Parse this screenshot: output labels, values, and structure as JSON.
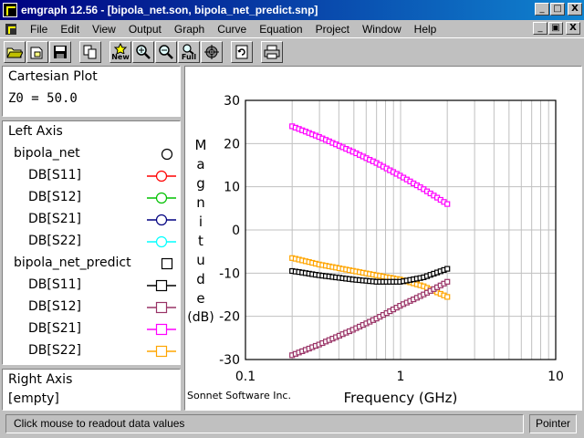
{
  "window": {
    "title": "emgraph 12.56 - [bipola_net.son, bipola_net_predict.snp]",
    "minimize": "_",
    "maximize": "□",
    "close": "X",
    "mdi_restore": "▣"
  },
  "menu": {
    "items": [
      {
        "label": "File",
        "key": "F",
        "rest": "ile"
      },
      {
        "label": "Edit",
        "key": "E",
        "rest": "dit"
      },
      {
        "label": "View",
        "key": "V",
        "rest": "iew"
      },
      {
        "label": "Output",
        "key": "O",
        "rest": "utput"
      },
      {
        "label": "Graph",
        "key": "G",
        "rest": "raph"
      },
      {
        "label": "Curve",
        "key": "C",
        "rest": "urve"
      },
      {
        "label": "Equation",
        "key": "q",
        "pre": "E",
        "rest": "uation"
      },
      {
        "label": "Project",
        "key": "P",
        "rest": "roject"
      },
      {
        "label": "Window",
        "key": "W",
        "rest": "indow"
      },
      {
        "label": "Help",
        "key": "H",
        "rest": "elp"
      }
    ]
  },
  "toolbar": {
    "new_label": "New",
    "full_label": "Full"
  },
  "left_panel": {
    "plot_type": "Cartesian Plot",
    "z0": "Z0 = 50.0",
    "left_axis_label": "Left Axis",
    "groups": [
      {
        "name": "bipola_net",
        "marker": "circle",
        "curves": [
          {
            "label": "DB[S11]",
            "color": "#ff0000"
          },
          {
            "label": "DB[S12]",
            "color": "#00c000"
          },
          {
            "label": "DB[S21]",
            "color": "#000080"
          },
          {
            "label": "DB[S22]",
            "color": "#00ffff"
          }
        ]
      },
      {
        "name": "bipola_net_predict",
        "marker": "square",
        "curves": [
          {
            "label": "DB[S11]",
            "color": "#000000"
          },
          {
            "label": "DB[S12]",
            "color": "#993366"
          },
          {
            "label": "DB[S21]",
            "color": "#ff00ff"
          },
          {
            "label": "DB[S22]",
            "color": "#ffa500"
          }
        ]
      }
    ],
    "right_axis_label": "Right Axis",
    "right_axis_value": "[empty]"
  },
  "chart_data": {
    "type": "line",
    "xscale": "log",
    "xlim": [
      0.1,
      10
    ],
    "ylim": [
      -30,
      30
    ],
    "xticks": [
      "0.1",
      "1",
      "10"
    ],
    "yticks": [
      "30",
      "20",
      "10",
      "0",
      "-10",
      "-20",
      "-30"
    ],
    "xlabel": "Frequency (GHz)",
    "ylabel_letters": [
      "M",
      "a",
      "g",
      "n",
      "i",
      "t",
      "u",
      "d",
      "e"
    ],
    "ylabel_unit": "(dB)",
    "grid": true,
    "footer": "Sonnet Software Inc.",
    "series": [
      {
        "group": "bipola_net_predict",
        "curve": "DB[S21]",
        "color": "#ff00ff",
        "x": [
          0.2,
          0.3,
          0.5,
          0.7,
          1.0,
          1.4,
          2.0
        ],
        "y": [
          24,
          21.5,
          18,
          15.5,
          12.5,
          9.5,
          6
        ]
      },
      {
        "group": "bipola_net_predict",
        "curve": "DB[S22]",
        "color": "#ffa500",
        "x": [
          0.2,
          0.3,
          0.5,
          0.7,
          1.0,
          1.4,
          2.0
        ],
        "y": [
          -6.5,
          -8,
          -9.5,
          -10.5,
          -11.5,
          -13,
          -15.5
        ]
      },
      {
        "group": "bipola_net_predict",
        "curve": "DB[S11]",
        "color": "#000000",
        "x": [
          0.2,
          0.3,
          0.5,
          0.7,
          1.0,
          1.4,
          2.0
        ],
        "y": [
          -9.5,
          -10.5,
          -11.5,
          -12,
          -12,
          -11,
          -9
        ]
      },
      {
        "group": "bipola_net_predict",
        "curve": "DB[S12]",
        "color": "#993366",
        "x": [
          0.2,
          0.3,
          0.5,
          0.7,
          1.0,
          1.4,
          2.0
        ],
        "y": [
          -29,
          -26.5,
          -23,
          -20.5,
          -17.5,
          -15,
          -12
        ]
      }
    ]
  },
  "status": {
    "message": "Click mouse to readout data values",
    "mode": "Pointer"
  }
}
